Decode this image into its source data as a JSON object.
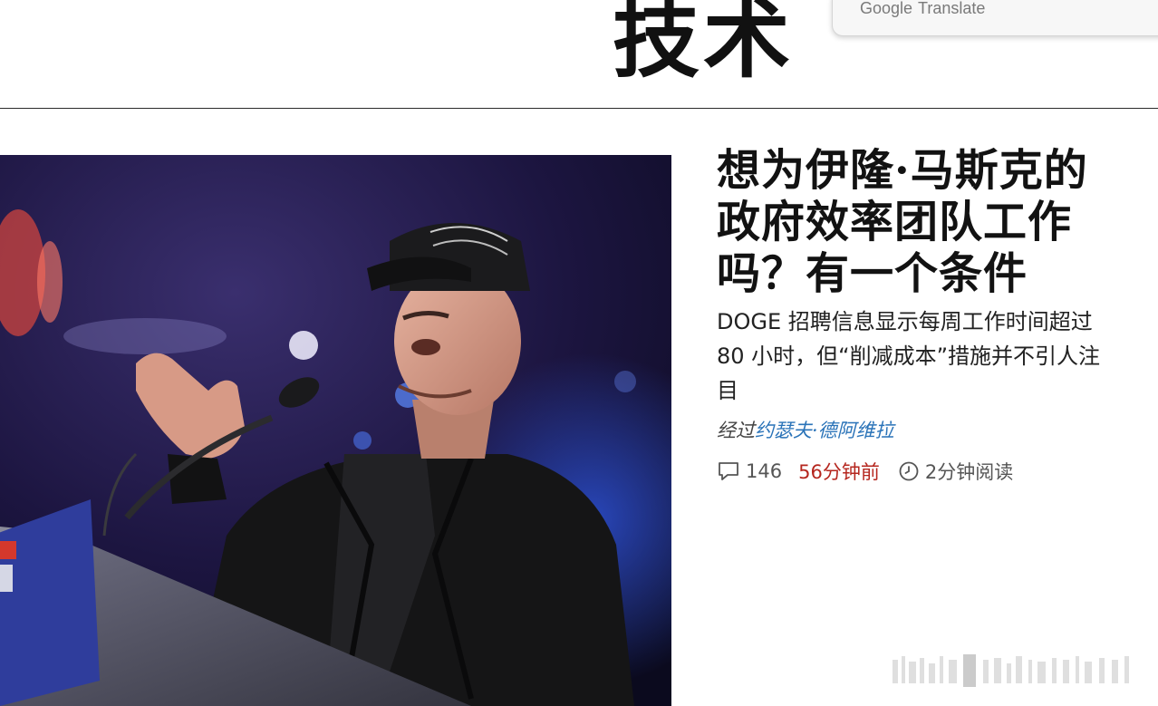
{
  "section": {
    "title": "技术"
  },
  "translate_bar": {
    "brand": "Google",
    "label": "Translate"
  },
  "article": {
    "headline": "想为伊隆·马斯克的政府效率团队工作吗？有一个条件",
    "dek": "DOGE 招聘信息显示每周工作时间超过 80 小时，但“削减成本”措施并不引人注目",
    "byline_prefix": "经过",
    "author": "约瑟夫·德阿维拉",
    "comment_count": "146",
    "time_ago": "56分钟前",
    "read_time": "2分钟阅读"
  },
  "icons": {
    "comment": "comment-icon",
    "clock": "clock-icon"
  },
  "colors": {
    "time_ago": "#b5261e",
    "author_link": "#2a73b8",
    "divider": "#2a2a2a"
  }
}
